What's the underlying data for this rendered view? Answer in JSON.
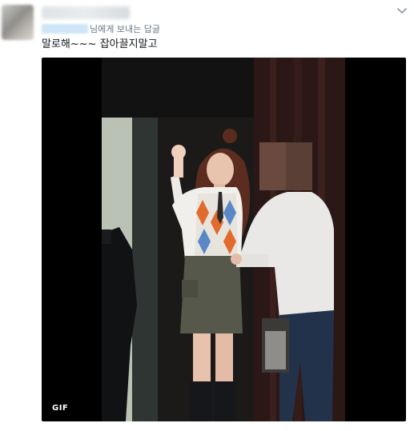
{
  "tweet": {
    "reply_suffix": "님에게 보내는 답글",
    "text": "말로해~~~ 잡아끌지말고"
  },
  "media": {
    "badge": "GIF"
  },
  "colors": {
    "background": "#ffffff",
    "text": "#14171a",
    "secondary_text": "#657786",
    "media_background": "#000000"
  },
  "icons": {
    "menu": "chevron-down-icon"
  }
}
